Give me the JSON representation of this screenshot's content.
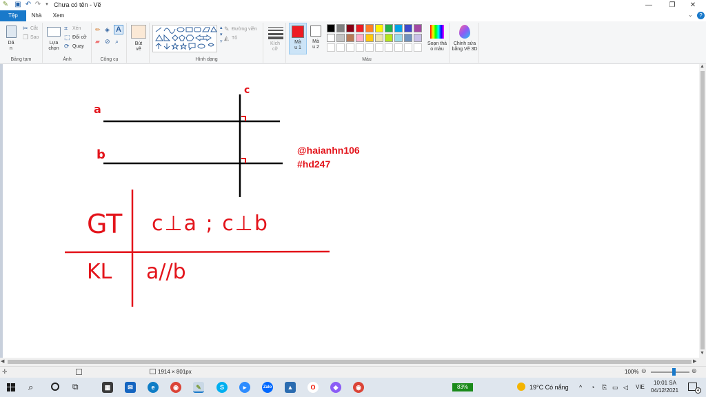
{
  "window": {
    "title": "Chưa có tên - Vẽ",
    "minimize_icon": "—",
    "maximize_icon": "❐",
    "close_icon": "✕"
  },
  "tabs": {
    "file": "Tệp",
    "home": "Nhà",
    "view": "Xem"
  },
  "ribbon": {
    "clipboard": {
      "paste": "Dá",
      "paste2": "n",
      "cut": "Cắt",
      "copy": "Sao",
      "label": "Bảng tạm"
    },
    "image": {
      "select": "Lựa",
      "select2": "chọn",
      "crop": "Xén",
      "resize": "Đổi cỡ",
      "rotate": "Quay",
      "label": "Ảnh"
    },
    "tools": {
      "label": "Công cụ"
    },
    "brushes": {
      "label1": "Bút",
      "label2": "vẽ"
    },
    "shapes": {
      "outline": "Đường viền",
      "fill": "Tô",
      "label": "Hình dạng"
    },
    "size": {
      "label1": "Kích",
      "label2": "cỡ"
    },
    "color1": {
      "label1": "Mà",
      "label2": "u 1",
      "value": "#ed1c24"
    },
    "color2": {
      "label1": "Mà",
      "label2": "u 2",
      "value": "#ffffff"
    },
    "colors": {
      "label": "Màu",
      "row1": [
        "#000000",
        "#7f7f7f",
        "#880015",
        "#ed1c24",
        "#ff7f27",
        "#fff200",
        "#22b14c",
        "#00a2e8",
        "#3f48cc",
        "#a349a4"
      ],
      "row2": [
        "#ffffff",
        "#c3c3c3",
        "#b97a57",
        "#ffaec9",
        "#ffc90e",
        "#efe4b0",
        "#b5e61d",
        "#99d9ea",
        "#7092be",
        "#c8bfe7"
      ]
    },
    "edit_colors": {
      "label1": "Soạn thả",
      "label2": "o màu"
    },
    "paint3d": {
      "label1": "Chỉnh sửa",
      "label2": "bằng Vẽ 3D"
    }
  },
  "canvas": {
    "watermark_user": "@haianhn106",
    "watermark_tag": "#hd247",
    "label_a": "a",
    "label_b": "b",
    "label_c": "c",
    "gt_label": "GT",
    "gt_text": "c⊥a ; c⊥b",
    "kl_label": "KL",
    "kl_text": "a//b"
  },
  "status": {
    "dimensions": "1914 × 801px",
    "zoom": "100%",
    "zoom_level": 100
  },
  "taskbar": {
    "battery": "83%",
    "weather": "19°C  Có nắng",
    "lang": "VIE",
    "time": "10:01 SA",
    "date": "04/12/2021",
    "notifications": "4"
  },
  "icons": {
    "save": "save-icon",
    "undo": "undo-icon",
    "redo": "redo-icon",
    "help": "help-icon",
    "windows": "windows-start-icon",
    "search": "search-icon",
    "cortana": "cortana-icon"
  }
}
